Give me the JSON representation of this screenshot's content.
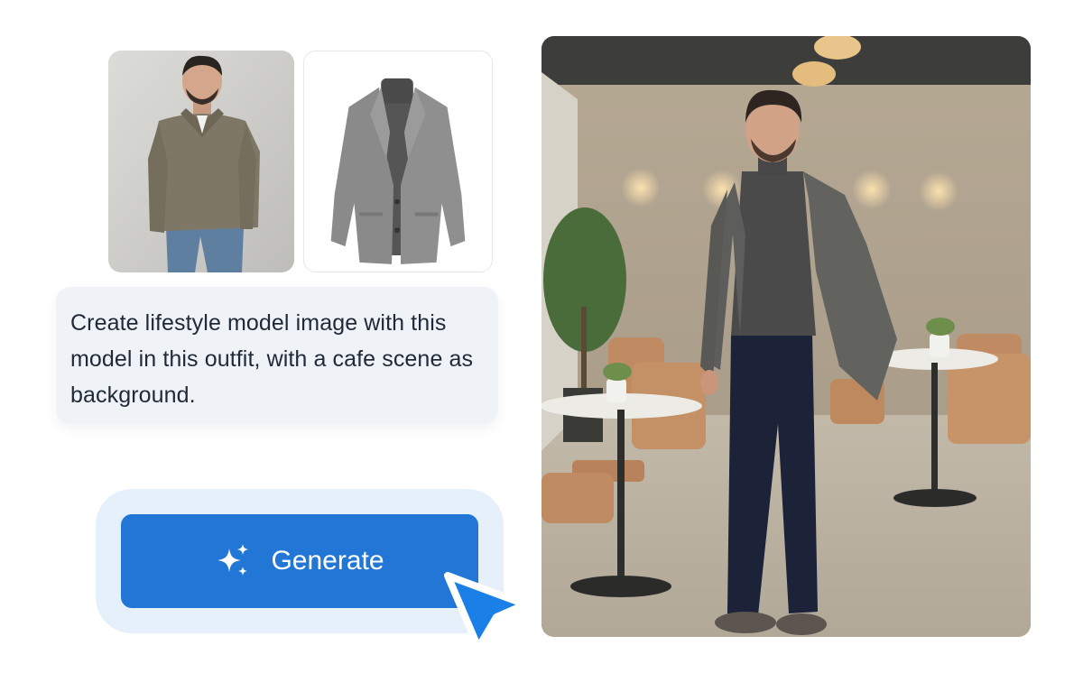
{
  "inputs": {
    "model_photo": {
      "icon": "model-portrait"
    },
    "outfit_photo": {
      "icon": "blazer-outfit"
    }
  },
  "prompt": {
    "text": "Create lifestyle model image with this model in this outfit, with a cafe scene as background."
  },
  "generate": {
    "label": "Generate",
    "icon": "sparkles-icon",
    "color": "#2277d6"
  },
  "cursor": {
    "icon": "pointer-cursor-icon",
    "color": "#1a7fe6"
  },
  "result": {
    "icon": "generated-cafe-image"
  }
}
